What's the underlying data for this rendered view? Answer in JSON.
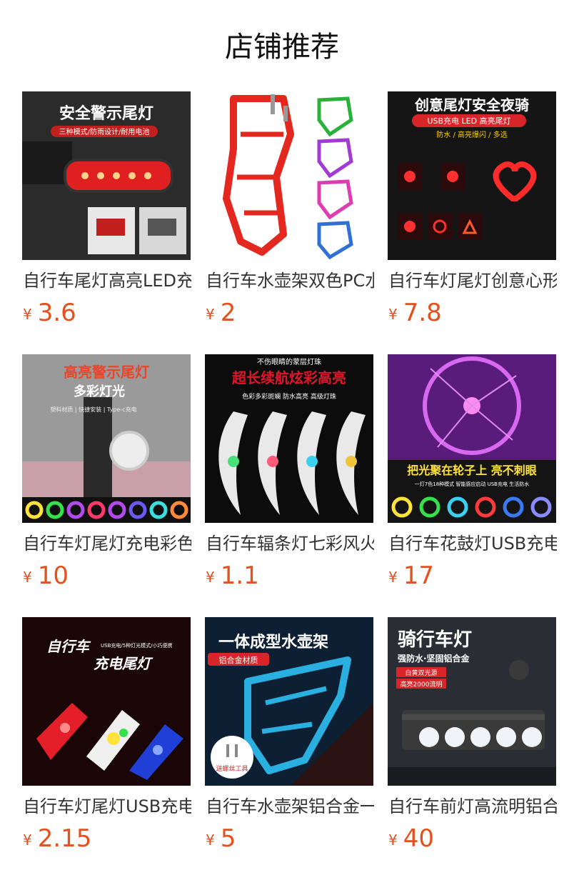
{
  "section_title": "店铺推荐",
  "currency_symbol": "¥",
  "products": [
    {
      "name": "自行车尾灯高亮LED充电安全警示灯",
      "price": "3.6",
      "thumb_title": "安全警示尾灯",
      "thumb_subtitle": "三种模式/防雨设计/耐用电池"
    },
    {
      "name": "自行车水壶架双色PC水杯架",
      "price": "2"
    },
    {
      "name": "自行车灯尾灯创意心形夜骑尾灯",
      "price": "7.8",
      "thumb_title": "创意尾灯安全夜骑",
      "thumb_subtitle": "USB充电 LED 高亮尾灯",
      "thumb_note": "防水 / 高亮爆闪 / 多选"
    },
    {
      "name": "自行车灯尾灯充电彩色警示灯",
      "price": "10",
      "thumb_title": "高亮警示尾灯",
      "thumb_subtitle": "多彩灯光",
      "thumb_note": "塑料材质 | 快捷安装 | Type-c充电"
    },
    {
      "name": "自行车辐条灯七彩风火轮钢丝灯",
      "price": "1.1",
      "thumb_title": "超长续航炫彩高亮",
      "thumb_subtitle": "不伤眼睛的蒙层灯珠",
      "thumb_note": "色彩多彩斑斓  防水高亮  高级灯珠"
    },
    {
      "name": "自行车花鼓灯USB充电轮子灯",
      "price": "17",
      "thumb_title": "把光聚在轮子上 亮不刺眼",
      "thumb_note": "一灯7色18种模式 智能感应启动 USB充电 生活防水"
    },
    {
      "name": "自行车灯尾灯USB充电警示灯",
      "price": "2.15",
      "thumb_title": "自行车",
      "thumb_subtitle": "充电尾灯",
      "thumb_note": "USB充电/5种灯光模式/小巧便携"
    },
    {
      "name": "自行车水壶架铝合金一体成型",
      "price": "5",
      "thumb_title": "一体成型水壶架",
      "thumb_subtitle": "铝合金材质",
      "thumb_note": "送螺丝工具"
    },
    {
      "name": "自行车前灯高流明铝合金骑行灯",
      "price": "40",
      "thumb_title": "骑行车灯",
      "thumb_subtitle": "强防水·坚固铝合金",
      "thumb_note": "白黄双光源",
      "thumb_note2": "高亮2000流明"
    }
  ]
}
